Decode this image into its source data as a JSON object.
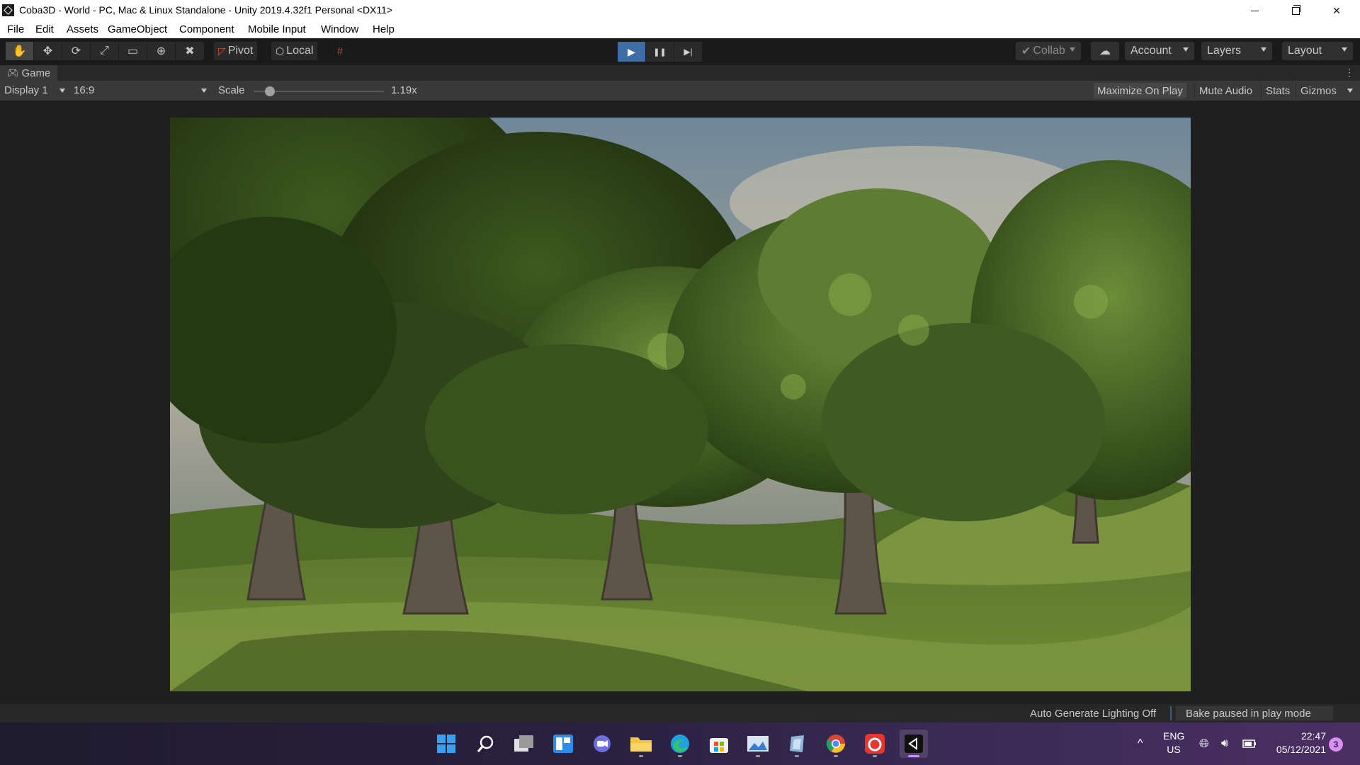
{
  "window": {
    "title": "Coba3D - World - PC, Mac & Linux Standalone - Unity 2019.4.32f1 Personal <DX11>",
    "minimize_icon": "minimize-icon",
    "maximize_icon": "restore-icon",
    "close_glyph": "✕"
  },
  "menu": [
    "File",
    "Edit",
    "Assets",
    "GameObject",
    "Component",
    "Mobile Input",
    "Window",
    "Help"
  ],
  "toolbar": {
    "tools": [
      {
        "name": "hand-tool",
        "glyph": "✋"
      },
      {
        "name": "move-tool",
        "glyph": "✥"
      },
      {
        "name": "rotate-tool",
        "glyph": "⟳"
      },
      {
        "name": "scale-tool",
        "glyph": "⤢"
      },
      {
        "name": "rect-tool",
        "glyph": "▭"
      },
      {
        "name": "transform-tool",
        "glyph": "⊕"
      },
      {
        "name": "custom-tool",
        "glyph": "✖"
      }
    ],
    "pivot_label": "Pivot",
    "local_label": "Local",
    "play_glyph": "▶",
    "pause_glyph": "❚❚",
    "step_glyph": "▶|",
    "collab_label": "Collab",
    "account_label": "Account",
    "layers_label": "Layers",
    "layout_label": "Layout",
    "accent_color": "#3f6ea6"
  },
  "game_tab": {
    "label": "Game",
    "menu_glyph": "⋮"
  },
  "game_controls": {
    "display": "Display 1",
    "aspect": "16:9",
    "scale_label": "Scale",
    "scale_value": "1.19x",
    "maximize_on_play": "Maximize On Play",
    "mute_audio": "Mute Audio",
    "stats": "Stats",
    "gizmos": "Gizmos"
  },
  "status": {
    "lighting": "Auto Generate Lighting Off",
    "bake": "Bake paused in play mode"
  },
  "taskbar": {
    "icons": [
      "windows-start-icon",
      "search-icon",
      "task-view-icon",
      "widgets-icon",
      "teams-chat-icon",
      "file-explorer-icon",
      "edge-browser-icon",
      "microsoft-store-icon",
      "photos-app-icon",
      "app-icon",
      "chrome-icon",
      "app-red-icon",
      "unity-icon"
    ],
    "tray_chevron": "^",
    "language": "ENG",
    "region": "US",
    "time": "22:47",
    "date": "05/12/2021",
    "notifications": "3"
  }
}
